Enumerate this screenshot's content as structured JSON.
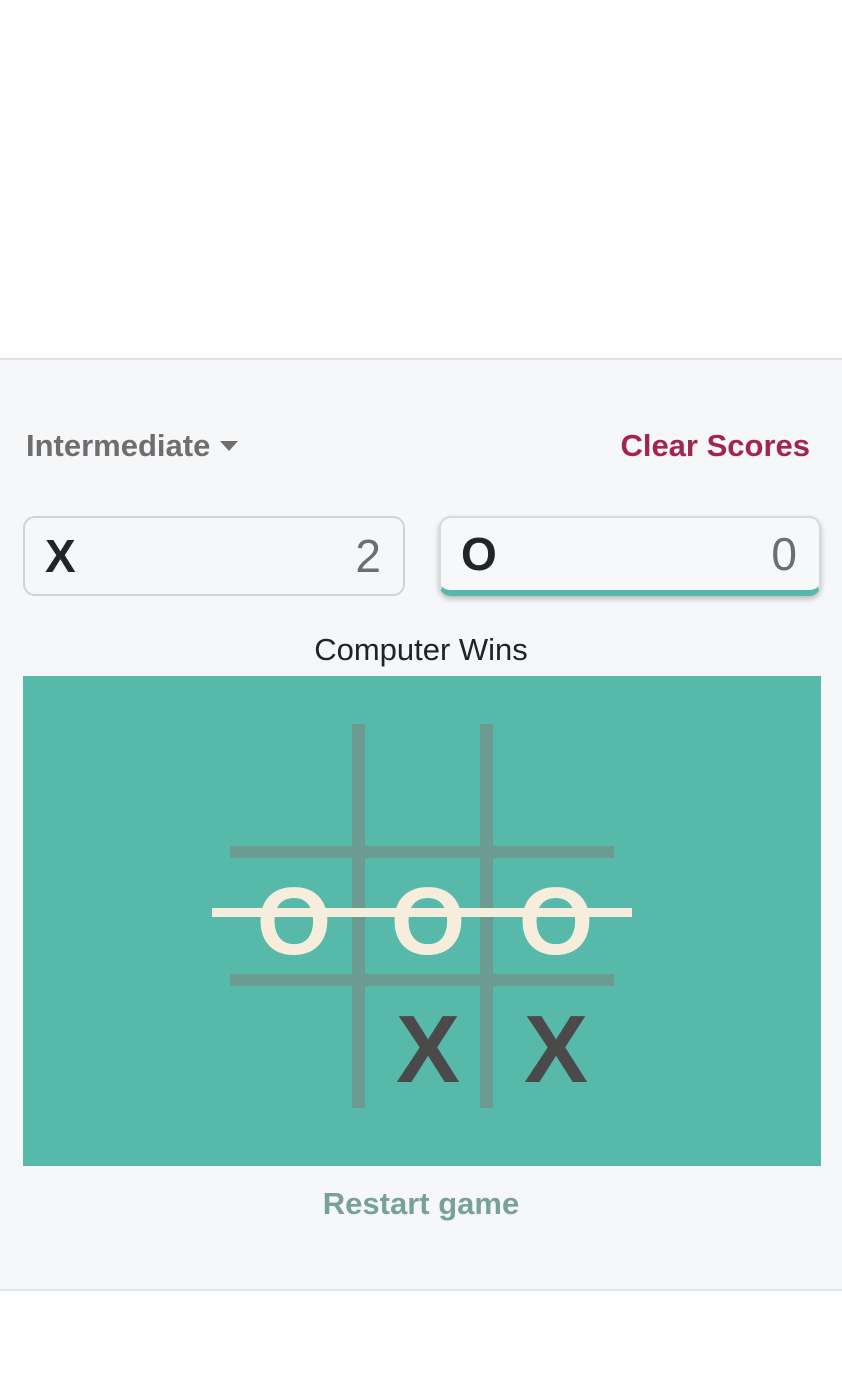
{
  "controls": {
    "difficulty": "Intermediate",
    "clear_scores": "Clear Scores"
  },
  "scores": {
    "x": {
      "label": "X",
      "value": "2"
    },
    "o": {
      "label": "O",
      "value": "0"
    }
  },
  "status": "Computer Wins",
  "board": {
    "cells": [
      "",
      "",
      "",
      "O",
      "O",
      "O",
      "",
      "X",
      "X"
    ],
    "winning_row": 1
  },
  "restart": "Restart game",
  "colors": {
    "board_bg": "#57b9aa",
    "grid_line": "#6c9b91",
    "o_mark": "#f7eddd",
    "x_mark": "#4a4a4a",
    "accent": "#a3244d",
    "active_underline": "#57b8aa"
  }
}
